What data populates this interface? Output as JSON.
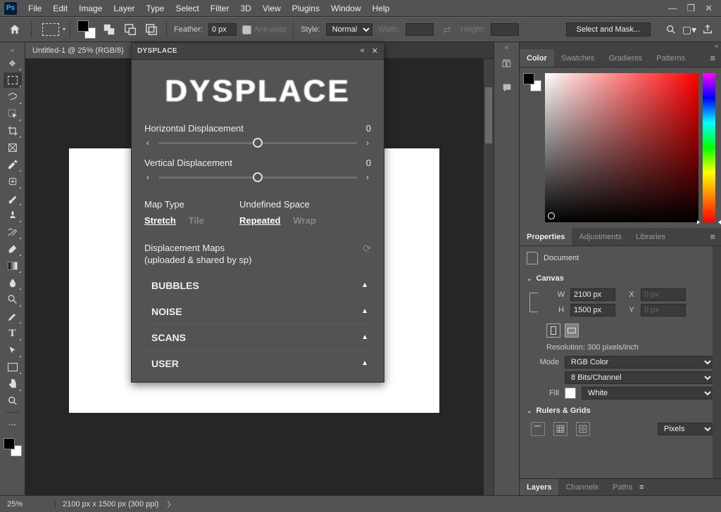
{
  "menu": {
    "items": [
      "File",
      "Edit",
      "Image",
      "Layer",
      "Type",
      "Select",
      "Filter",
      "3D",
      "View",
      "Plugins",
      "Window",
      "Help"
    ]
  },
  "options": {
    "feather_label": "Feather:",
    "feather_value": "0 px",
    "antialias_label": "Anti-alias",
    "style_label": "Style:",
    "style_value": "Normal",
    "width_label": "Width:",
    "height_label": "Height:",
    "mask_button": "Select and Mask..."
  },
  "document": {
    "tab_title": "Untitled-1 @ 25% (RGB/8)"
  },
  "dysplace": {
    "panel_title": "DYSPLACE",
    "logo": "DYSPLACE",
    "h_label": "Horizontal Displacement",
    "h_value": "0",
    "v_label": "Vertical Displacement",
    "v_value": "0",
    "map_type_label": "Map Type",
    "map_type_opts": {
      "stretch": "Stretch",
      "tile": "Tile"
    },
    "undef_label": "Undefined Space",
    "undef_opts": {
      "repeated": "Repeated",
      "wrap": "Wrap"
    },
    "maps_heading": "Displacement Maps",
    "maps_sub": "(uploaded & shared by sp)",
    "maps_items": [
      "BUBBLES",
      "NOISE",
      "SCANS",
      "USER"
    ]
  },
  "color_tabs": {
    "color": "Color",
    "swatches": "Swatches",
    "gradients": "Gradients",
    "patterns": "Patterns"
  },
  "props_tabs": {
    "properties": "Properties",
    "adjustments": "Adjustments",
    "libraries": "Libraries"
  },
  "properties": {
    "doc_label": "Document",
    "canvas_heading": "Canvas",
    "w_label": "W",
    "w_value": "2100 px",
    "h_label": "H",
    "h_value": "1500 px",
    "x_label": "X",
    "x_value": "0 px",
    "y_label": "Y",
    "y_value": "0 px",
    "resolution_label": "Resolution:",
    "resolution_value": "300 pixels/inch",
    "mode_label": "Mode",
    "mode_value": "RGB Color",
    "bits_value": "8 Bits/Channel",
    "fill_label": "Fill",
    "fill_value": "White",
    "rulers_heading": "Rulers & Grids",
    "rulers_unit": "Pixels"
  },
  "bottom_tabs": {
    "layers": "Layers",
    "channels": "Channels",
    "paths": "Paths"
  },
  "statusbar": {
    "zoom": "25%",
    "doc_info": "2100 px x 1500 px (300 ppi)"
  }
}
